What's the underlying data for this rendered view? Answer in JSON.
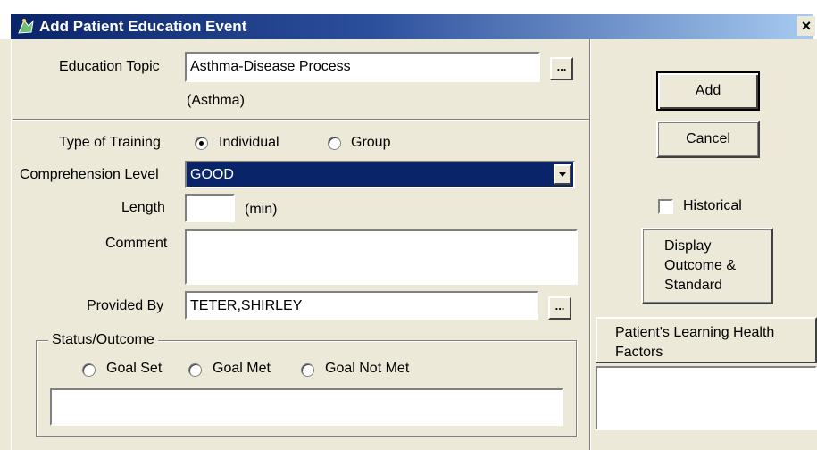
{
  "window": {
    "title": "Add Patient Education Event",
    "close_label": "×"
  },
  "education_topic": {
    "label": "Education Topic",
    "value": "Asthma-Disease Process",
    "category": "(Asthma)",
    "browse_label": "..."
  },
  "type_of_training": {
    "label": "Type of Training",
    "options": [
      "Individual",
      "Group"
    ],
    "selected": "Individual"
  },
  "comprehension_level": {
    "label": "Comprehension Level",
    "value": "GOOD"
  },
  "length": {
    "label": "Length",
    "value": "",
    "unit": "(min)"
  },
  "comment": {
    "label": "Comment",
    "value": ""
  },
  "provided_by": {
    "label": "Provided By",
    "value": "TETER,SHIRLEY",
    "browse_label": "..."
  },
  "status_outcome": {
    "label": "Status/Outcome",
    "options": [
      "Goal Set",
      "Goal Met",
      "Goal Not Met"
    ],
    "value": ""
  },
  "buttons": {
    "add": "Add",
    "cancel": "Cancel",
    "display_outcome_line1": "Display",
    "display_outcome_line2": "Outcome &",
    "display_outcome_line3": "Standard"
  },
  "historical": {
    "label": "Historical",
    "checked": false
  },
  "learning_health": {
    "header_line1": "Patient's Learning Health",
    "header_line2": "Factors"
  }
}
